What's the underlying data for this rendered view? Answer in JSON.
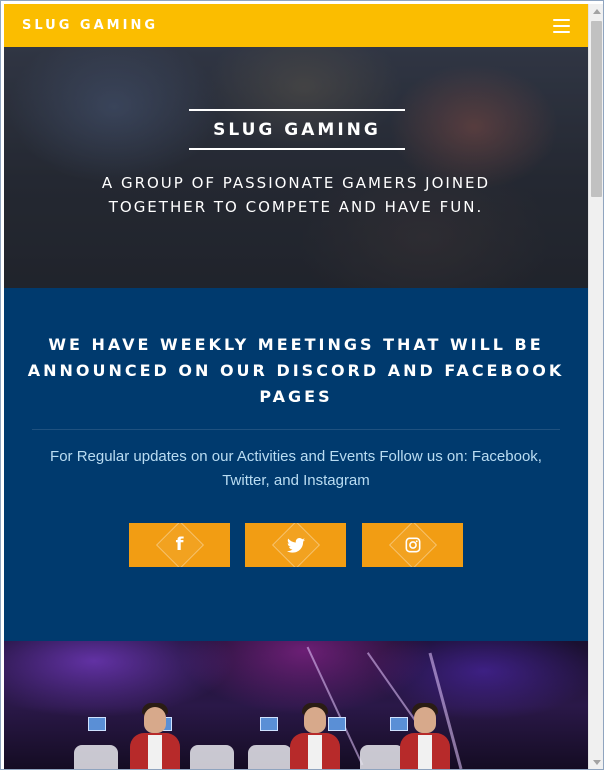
{
  "navbar": {
    "brand": "SLUG GAMING",
    "menu_icon": "hamburger-menu-icon"
  },
  "hero": {
    "title": "SLUG GAMING",
    "subtitle": "A GROUP OF PASSIONATE GAMERS JOINED TOGETHER TO COMPETE AND HAVE FUN."
  },
  "info": {
    "heading": "WE HAVE WEEKLY MEETINGS THAT WILL BE ANNOUNCED ON OUR DISCORD AND FACEBOOK PAGES",
    "text": "For Regular updates on our Activities and Events Follow us on: Facebook, Twitter, and Instagram",
    "social": [
      {
        "name": "facebook",
        "icon": "facebook-icon",
        "glyph": "f"
      },
      {
        "name": "twitter",
        "icon": "twitter-icon",
        "glyph": ""
      },
      {
        "name": "instagram",
        "icon": "instagram-icon",
        "glyph": ""
      }
    ]
  },
  "colors": {
    "navbar_bg": "#fbbd00",
    "info_bg": "#003a6e",
    "social_btn_bg": "#f29d13",
    "info_text": "#b9dcf2"
  }
}
